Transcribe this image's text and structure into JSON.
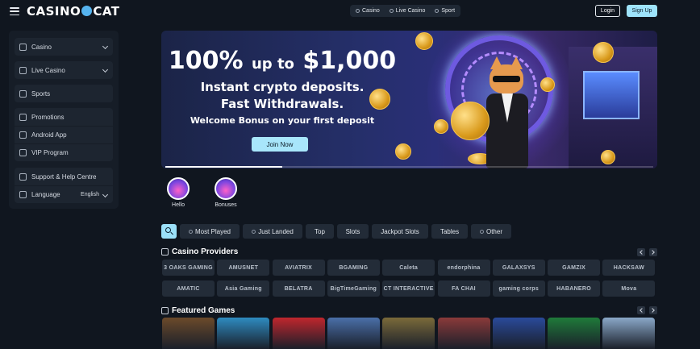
{
  "header": {
    "logo": "CASINOCAT",
    "nav_tabs": [
      {
        "label": "Casino",
        "icon": "casino-icon"
      },
      {
        "label": "Live Casino",
        "icon": "live-casino-icon"
      },
      {
        "label": "Sport",
        "icon": "sport-icon"
      }
    ],
    "login_label": "Login",
    "signup_label": "Sign Up"
  },
  "sidebar": {
    "groups": [
      [
        {
          "label": "Casino",
          "icon": "casino-icon",
          "expandable": true
        }
      ],
      [
        {
          "label": "Live Casino",
          "icon": "live-casino-icon",
          "expandable": true
        }
      ],
      [
        {
          "label": "Sports",
          "icon": "sports-icon"
        }
      ],
      [
        {
          "label": "Promotions",
          "icon": "gift-icon"
        },
        {
          "label": "Android App",
          "icon": "android-icon"
        },
        {
          "label": "VIP Program",
          "icon": "vip-icon"
        }
      ],
      [
        {
          "label": "Support & Help Centre",
          "icon": "support-icon"
        },
        {
          "label": "Language",
          "icon": "globe-icon",
          "value": "English",
          "expandable": true
        }
      ]
    ]
  },
  "banner": {
    "headline_big": "100%",
    "headline_small": "up to",
    "headline_amount": "$1,000",
    "line1": "Instant crypto deposits.",
    "line2": "Fast Withdrawals.",
    "welcome": "Welcome Bonus on your first deposit",
    "cta_label": "Join Now",
    "progress": 0.24
  },
  "stories": [
    {
      "label": "Hello"
    },
    {
      "label": "Bonuses"
    }
  ],
  "filters": [
    {
      "label": "Most Played",
      "icon": "star-icon"
    },
    {
      "label": "Just Landed",
      "icon": "sparkle-icon"
    },
    {
      "label": "Top"
    },
    {
      "label": "Slots"
    },
    {
      "label": "Jackpot Slots"
    },
    {
      "label": "Tables"
    },
    {
      "label": "Other",
      "icon": "grid-icon"
    }
  ],
  "providers_section": {
    "title": "Casino Providers",
    "providers": [
      "3 OAKS GAMING",
      "AMUSNET",
      "AVIATRIX",
      "BGAMING",
      "Caleta",
      "endorphina",
      "GALAXSYS",
      "GAMZIX",
      "HACKSAW",
      "AMATIC",
      "Asia Gaming",
      "BELATRA",
      "BigTimeGaming",
      "CT INTERACTIVE",
      "FA CHAI",
      "gaming corps",
      "HABANERO",
      "Mova"
    ]
  },
  "games_section": {
    "title": "Featured Games",
    "games": [
      {
        "name": "tiger-game",
        "color": "#6b4a2a"
      },
      {
        "name": "leprechaun-game",
        "color": "#2e8bc0"
      },
      {
        "name": "88-game",
        "color": "#c0262d"
      },
      {
        "name": "mountain-game",
        "color": "#4a6fa8"
      },
      {
        "name": "explorer-game",
        "color": "#7a6a3a"
      },
      {
        "name": "grandma-game",
        "color": "#8a3a3a"
      },
      {
        "name": "crystals-game",
        "color": "#2a4a9a"
      },
      {
        "name": "green-orb-game",
        "color": "#1f7a3a"
      },
      {
        "name": "wolf-game",
        "color": "#8aa8c8"
      }
    ]
  }
}
